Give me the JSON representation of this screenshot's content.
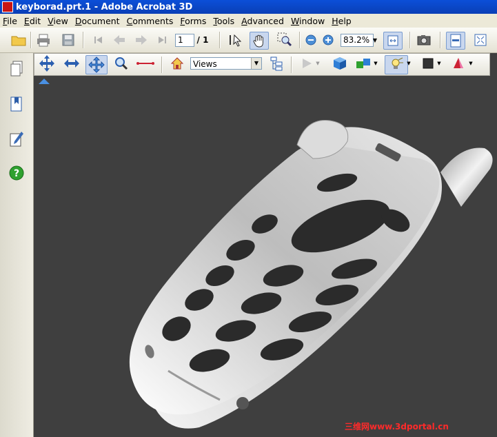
{
  "window": {
    "title": "keyborad.prt.1 - Adobe Acrobat 3D"
  },
  "menu": [
    {
      "label": "File",
      "u": "F",
      "rest": "ile"
    },
    {
      "label": "Edit",
      "u": "E",
      "rest": "dit"
    },
    {
      "label": "View",
      "u": "V",
      "rest": "iew"
    },
    {
      "label": "Document",
      "u": "D",
      "rest": "ocument"
    },
    {
      "label": "Comments",
      "u": "C",
      "rest": "omments"
    },
    {
      "label": "Forms",
      "u": "F",
      "rest": "orms"
    },
    {
      "label": "Tools",
      "u": "T",
      "rest": "ools"
    },
    {
      "label": "Advanced",
      "u": "A",
      "rest": "dvanced"
    },
    {
      "label": "Window",
      "u": "W",
      "rest": "indow"
    },
    {
      "label": "Help",
      "u": "H",
      "rest": "elp"
    }
  ],
  "toolbar": {
    "page_current": "1",
    "page_total": "/ 1",
    "zoom": "83.2%"
  },
  "toolbar3d": {
    "views_select": "Views"
  },
  "watermark": "三维网www.3dportal.cn",
  "colors": {
    "title_bar": "#0b4fd8",
    "viewport_bg": "#3f3f3f",
    "help_icon": "#2fa12f"
  }
}
